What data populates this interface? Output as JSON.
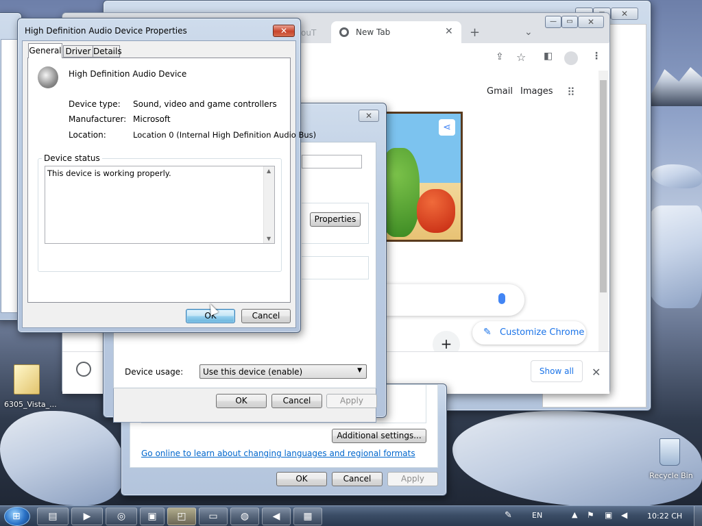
{
  "desktop": {
    "folder_label": "6305_Vista_...",
    "recycle_bin_label": "Recycle Bin"
  },
  "chrome": {
    "tab_partial": "ouT",
    "tab_title": "New Tab",
    "links": {
      "gmail": "Gmail",
      "images": "Images"
    },
    "customize": "Customize Chrome",
    "downloads_show_all": "Show all"
  },
  "back_dialog": {
    "properties_button": "Properties",
    "device_usage_label": "Device usage:",
    "device_usage_value": "Use this device (enable)",
    "ok": "OK",
    "cancel": "Cancel",
    "apply": "Apply"
  },
  "region_dialog": {
    "additional_settings": "Additional settings...",
    "online_link": "Go online to learn about changing languages and regional formats",
    "ok": "OK",
    "cancel": "Cancel",
    "apply": "Apply"
  },
  "props": {
    "title": "High Definition Audio Device Properties",
    "tabs": [
      "General",
      "Driver",
      "Details"
    ],
    "device_name": "High Definition Audio Device",
    "device_type_label": "Device type:",
    "device_type_value": "Sound, video and game controllers",
    "manufacturer_label": "Manufacturer:",
    "manufacturer_value": "Microsoft",
    "location_label": "Location:",
    "location_value": "Location 0 (Internal High Definition Audio Bus)",
    "status_group": "Device status",
    "status_text": "This device is working properly.",
    "ok": "OK",
    "cancel": "Cancel"
  },
  "taskbar": {
    "lang": "EN",
    "clock": "10:22 CH"
  }
}
